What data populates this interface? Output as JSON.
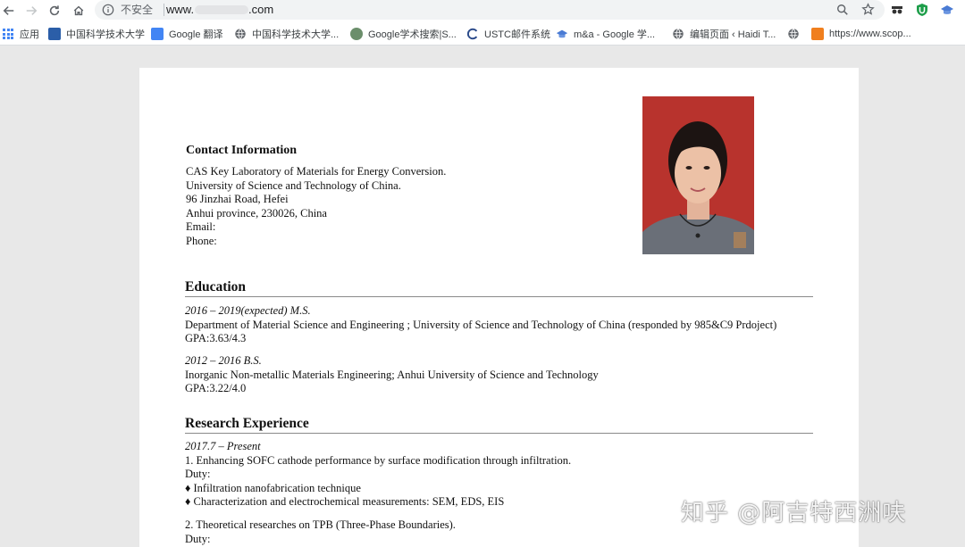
{
  "browser": {
    "insecure_label": "不安全",
    "url_prefix": "www.",
    "url_suffix": ".com",
    "accent_color": "#4285f4"
  },
  "bookmarks": [
    {
      "label": "应用",
      "icon": "apps-grid-icon"
    },
    {
      "label": "中国科学技术大学",
      "icon": "ustc-logo-icon"
    },
    {
      "label": "Google 翻译",
      "icon": "google-translate-icon"
    },
    {
      "label": "中国科学技术大学...",
      "icon": "globe-icon"
    },
    {
      "label": "Google学术搜索|S...",
      "icon": "google-scholar-icon"
    },
    {
      "label": "USTC邮件系统",
      "icon": "mail-icon"
    },
    {
      "label": "m&a - Google 学...",
      "icon": "scholar-cap-icon"
    },
    {
      "label": "编辑页面 ‹ Haidi T...",
      "icon": "globe-icon"
    },
    {
      "label": "",
      "icon": "globe-icon"
    },
    {
      "label": "https://www.scop...",
      "icon": "scopus-icon"
    }
  ],
  "resume": {
    "contact": {
      "heading": "Contact Information",
      "lines": [
        "CAS Key Laboratory of Materials for Energy Conversion.",
        "University of Science and Technology of China.",
        "96 Jinzhai Road, Hefei",
        "Anhui province, 230026, China",
        "Email:",
        "Phone:"
      ]
    },
    "education": {
      "heading": "Education",
      "entries": [
        {
          "period": "2016 – 2019(expected) M.S.",
          "detail": "Department of Material Science and Engineering ; University of Science and Technology of China (responded by 985&C9 Prdoject)",
          "gpa": "GPA:3.63/4.3"
        },
        {
          "period": "2012 – 2016 B.S.",
          "detail": "Inorganic Non-metallic Materials Engineering; Anhui University of Science and Technology",
          "gpa": "GPA:3.22/4.0"
        }
      ]
    },
    "research": {
      "heading": "Research Experience",
      "period": "2017.7 – Present",
      "project1": "1. Enhancing SOFC cathode performance by surface modification through infiltration.",
      "duty_label": "Duty:",
      "bullets": [
        "♦ Infiltration nanofabrication technique",
        "♦ Characterization and electrochemical measurements: SEM, EDS, EIS"
      ],
      "project2": "2. Theoretical researches on TPB (Three-Phase Boundaries).",
      "duty_label_2": "Duty:"
    }
  },
  "watermark": "知乎 @阿吉特西洲呋"
}
